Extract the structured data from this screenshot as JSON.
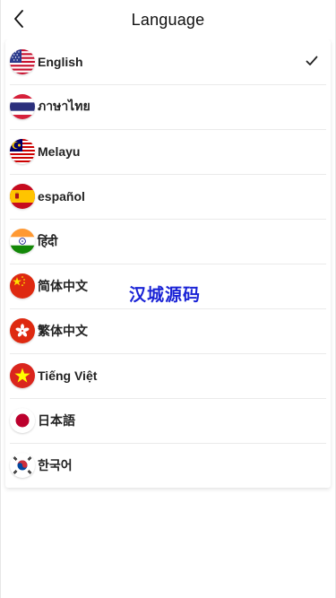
{
  "header": {
    "title": "Language",
    "back_icon": "chevron-left-icon"
  },
  "languages": [
    {
      "label": "English",
      "flag": "us-flag-icon",
      "selected": true
    },
    {
      "label": "ภาษาไทย",
      "flag": "thailand-flag-icon",
      "selected": false
    },
    {
      "label": "Melayu",
      "flag": "malaysia-flag-icon",
      "selected": false
    },
    {
      "label": "español",
      "flag": "spain-flag-icon",
      "selected": false
    },
    {
      "label": "हिंदी",
      "flag": "india-flag-icon",
      "selected": false
    },
    {
      "label": "简体中文",
      "flag": "china-flag-icon",
      "selected": false
    },
    {
      "label": "繁体中文",
      "flag": "hong-kong-flag-icon",
      "selected": false
    },
    {
      "label": "Tiếng Việt",
      "flag": "vietnam-flag-icon",
      "selected": false
    },
    {
      "label": "日本語",
      "flag": "japan-flag-icon",
      "selected": false
    },
    {
      "label": "한국어",
      "flag": "korea-flag-icon",
      "selected": false
    }
  ],
  "watermark": "汉城源码",
  "colors": {
    "text": "#222222",
    "divider": "#eaeaea",
    "watermark": "#1a23d6"
  }
}
